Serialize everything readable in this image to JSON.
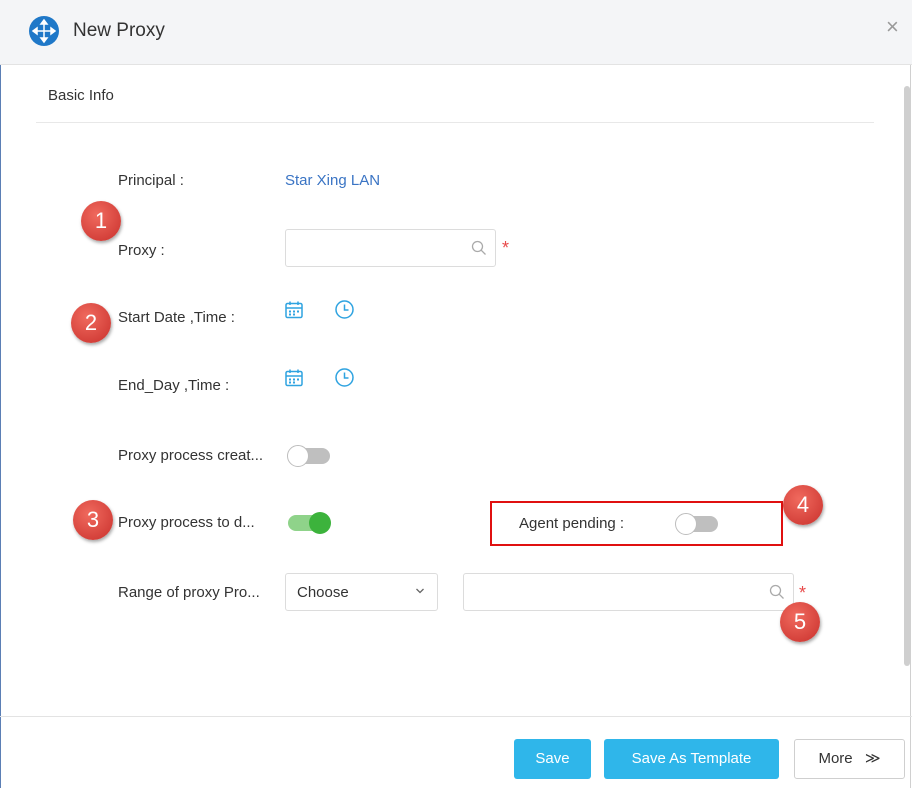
{
  "window": {
    "title": "New Proxy",
    "close_symbol": "×",
    "app_icon": "move-arrows-icon"
  },
  "section": {
    "title": "Basic Info"
  },
  "form": {
    "principal_label": "Principal :",
    "principal_value": "Star Xing LAN",
    "proxy_label": "Proxy :",
    "proxy_value": "",
    "start_label": "Start Date ,Time :",
    "end_label": "End_Day ,Time :",
    "proxy_create_label": "Proxy process creat...",
    "proxy_create_on": false,
    "proxy_todo_label": "Proxy process to d...",
    "proxy_todo_on": true,
    "agent_pending_label": "Agent pending :",
    "agent_pending_on": false,
    "range_label": "Range of proxy Pro...",
    "range_select": "Choose",
    "range_value": "",
    "required_mark": "*"
  },
  "annotations": [
    "1",
    "2",
    "3",
    "4",
    "5"
  ],
  "footer": {
    "save": "Save",
    "save_template": "Save As Template",
    "more": "More",
    "more_symbol": "≫"
  },
  "colors": {
    "accent": "#2fb6ea",
    "link": "#3a74c4",
    "toggle_on": "#3cb33c",
    "required": "#e84a4a",
    "annotation": "#d9413a",
    "highlight": "#e01010"
  }
}
